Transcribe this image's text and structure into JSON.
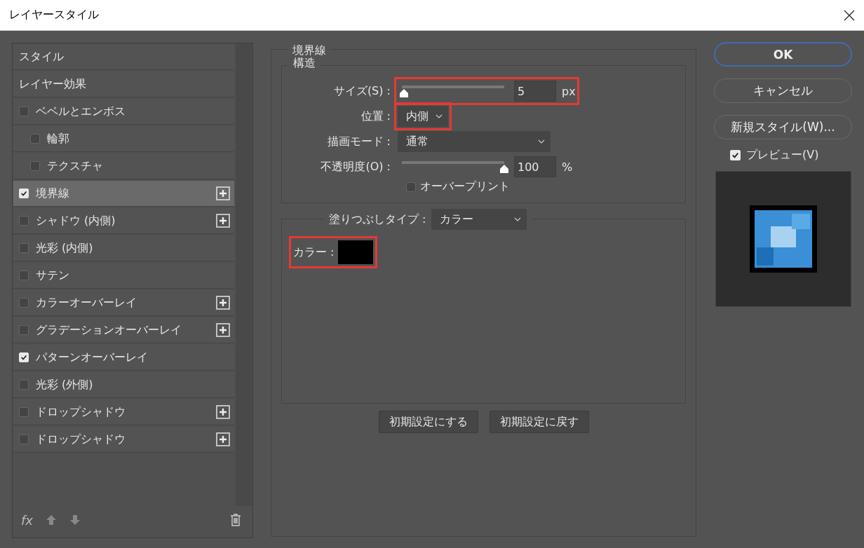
{
  "window": {
    "title": "レイヤースタイル"
  },
  "sidebar": {
    "items": [
      {
        "kind": "header",
        "label": "スタイル",
        "selected": false
      },
      {
        "kind": "header",
        "label": "レイヤー効果",
        "selected": false
      },
      {
        "kind": "check",
        "label": "ベベルとエンボス",
        "checked": false,
        "selected": false,
        "add": false,
        "children": [
          {
            "kind": "check",
            "label": "輪郭",
            "checked": false,
            "selected": false,
            "add": false
          },
          {
            "kind": "check",
            "label": "テクスチャ",
            "checked": false,
            "selected": false,
            "add": false
          }
        ]
      },
      {
        "kind": "check",
        "label": "境界線",
        "checked": true,
        "selected": true,
        "add": true
      },
      {
        "kind": "check",
        "label": "シャドウ (内側)",
        "checked": false,
        "selected": false,
        "add": true
      },
      {
        "kind": "check",
        "label": "光彩 (内側)",
        "checked": false,
        "selected": false,
        "add": false
      },
      {
        "kind": "check",
        "label": "サテン",
        "checked": false,
        "selected": false,
        "add": false
      },
      {
        "kind": "check",
        "label": "カラーオーバーレイ",
        "checked": false,
        "selected": false,
        "add": true
      },
      {
        "kind": "check",
        "label": "グラデーションオーバーレイ",
        "checked": false,
        "selected": false,
        "add": true
      },
      {
        "kind": "check",
        "label": "パターンオーバーレイ",
        "checked": true,
        "selected": false,
        "add": false
      },
      {
        "kind": "check",
        "label": "光彩 (外側)",
        "checked": false,
        "selected": false,
        "add": false
      },
      {
        "kind": "check",
        "label": "ドロップシャドウ",
        "checked": false,
        "selected": false,
        "add": true
      },
      {
        "kind": "check",
        "label": "ドロップシャドウ",
        "checked": false,
        "selected": false,
        "add": true
      }
    ],
    "footer": {
      "fx": "fx"
    }
  },
  "panel": {
    "title": "境界線",
    "structure": {
      "title": "構造",
      "size": {
        "label": "サイズ(S) :",
        "level": 0.02,
        "value": "5",
        "unit": "px",
        "highlighted": true
      },
      "position": {
        "label": "位置 :",
        "value": "内側",
        "highlighted": true
      },
      "blend_mode": {
        "label": "描画モード :",
        "value": "通常"
      },
      "opacity": {
        "label": "不透明度(O) :",
        "level": 1,
        "value": "100",
        "unit": "%"
      },
      "overprint": {
        "label": "オーバープリント",
        "checked": false
      }
    },
    "fill": {
      "label": "塗りつぶしタイプ :",
      "value": "カラー",
      "color": {
        "label": "カラー :",
        "color": "#000000",
        "highlighted": true
      }
    },
    "buttons": [
      "初期設定にする",
      "初期設定に戻す"
    ]
  },
  "actions": {
    "buttons": [
      {
        "label": "OK",
        "default": true
      },
      {
        "label": "キャンセル",
        "default": false
      },
      {
        "label": "新規スタイル(W)...",
        "default": false
      }
    ],
    "preview": {
      "label": "プレビュー(V)",
      "checked": true
    }
  }
}
